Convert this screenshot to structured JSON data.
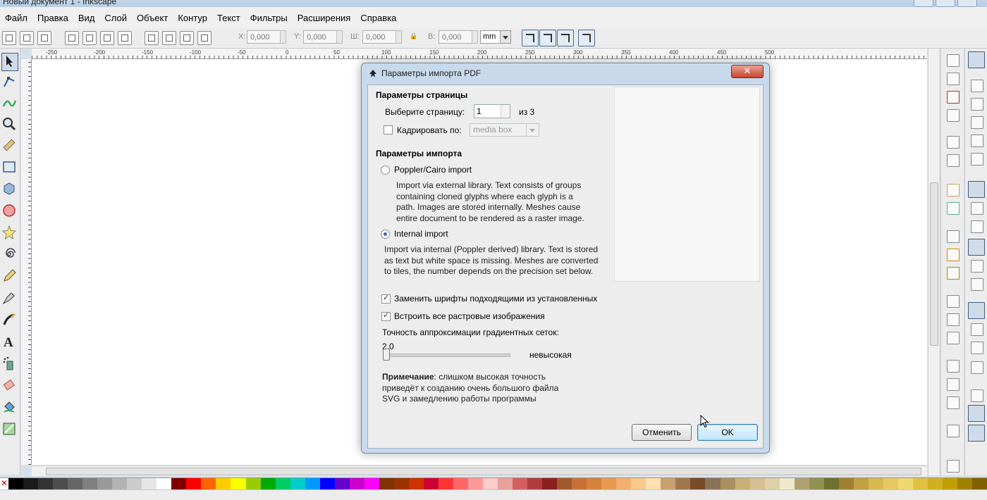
{
  "window": {
    "title": "Новый документ 1 - Inkscape"
  },
  "menu": [
    "Файл",
    "Правка",
    "Вид",
    "Слой",
    "Объект",
    "Контур",
    "Текст",
    "Фильтры",
    "Расширения",
    "Справка"
  ],
  "toolbar": {
    "x_label": "X:",
    "x_value": "0,000",
    "y_label": "Y:",
    "y_value": "0,000",
    "w_label": "Ш:",
    "w_value": "0,000",
    "h_label": "В:",
    "h_value": "0,000",
    "unit": "mm"
  },
  "ruler": {
    "top_ticks": [
      "-250",
      "-200",
      "-150",
      "-100",
      "-50",
      "0",
      "50",
      "100",
      "150",
      "200",
      "250",
      "300",
      "350",
      "400",
      "450",
      "500"
    ]
  },
  "tools": [
    "selector-tool",
    "node-tool",
    "tweak-tool",
    "zoom-tool",
    "measure-tool",
    "rect-tool",
    "3dbox-tool",
    "ellipse-tool",
    "star-tool",
    "spiral-tool",
    "pencil-tool",
    "pen-tool",
    "calligraphy-tool",
    "text-tool",
    "spray-tool",
    "eraser-tool",
    "bucket-tool",
    "gradient-tool"
  ],
  "dialog": {
    "title": "Параметры импорта PDF",
    "page_section": "Параметры страницы",
    "select_page_label": "Выберите страницу:",
    "page_value": "1",
    "of_pages": "из 3",
    "crop_label": "Кадрировать по:",
    "crop_option": "media box",
    "import_section": "Параметры импорта",
    "poppler_label": "Poppler/Cairo import",
    "poppler_desc": "Import via external library. Text consists of groups containing cloned glyphs where each glyph is a path. Images are stored internally. Meshes cause entire document to be rendered as a raster image.",
    "internal_label": "Internal import",
    "internal_desc": "Import via internal (Poppler derived) library. Text is stored as text but white space is missing. Meshes are converted to tiles, the number depends on the precision set below.",
    "replace_fonts_label": "Заменить шрифты подходящими из установленных",
    "embed_images_label": "Встроить все растровые изображения",
    "precision_label": "Точность аппроксимации градиентных сеток:",
    "precision_value": "2,0",
    "precision_level": "невысокая",
    "note_bold": "Примечание",
    "note_text": ": слишком высокая точность приведёт к созданию очень большого файла SVG и замедлению работы программы",
    "cancel_label": "Отменить",
    "ok_label": "OK"
  },
  "palette": [
    "#000000",
    "#1a1a1a",
    "#333333",
    "#4d4d4d",
    "#666666",
    "#808080",
    "#999999",
    "#b3b3b3",
    "#cccccc",
    "#e6e6e6",
    "#ffffff",
    "#800000",
    "#ff0000",
    "#ff6600",
    "#ffcc00",
    "#ffff00",
    "#99cc00",
    "#00aa00",
    "#00cc66",
    "#00cccc",
    "#0099ff",
    "#0000ff",
    "#6600cc",
    "#cc00cc",
    "#ff00ff",
    "#803300",
    "#993300",
    "#cc3300",
    "#cc0033",
    "#ff3333",
    "#ff6666",
    "#ff9999",
    "#ffcccc",
    "#e6a19a",
    "#d45d5d",
    "#b33a3a",
    "#8c1f1f",
    "#a05a2c",
    "#c87137",
    "#d4823c",
    "#e69a4e",
    "#f2b06c",
    "#f7c98f",
    "#ffe0b3",
    "#c8a070",
    "#a0784c",
    "#784c28",
    "#8b7355",
    "#a89060",
    "#c8b078",
    "#d4c090",
    "#e0d0a8",
    "#f0e8cc",
    "#b0a070",
    "#909050",
    "#707030",
    "#a08030",
    "#c0a040",
    "#d8b850",
    "#e8c860",
    "#f0d870",
    "#e0c040",
    "#d0b020",
    "#c0a000",
    "#a08000",
    "#806000"
  ]
}
